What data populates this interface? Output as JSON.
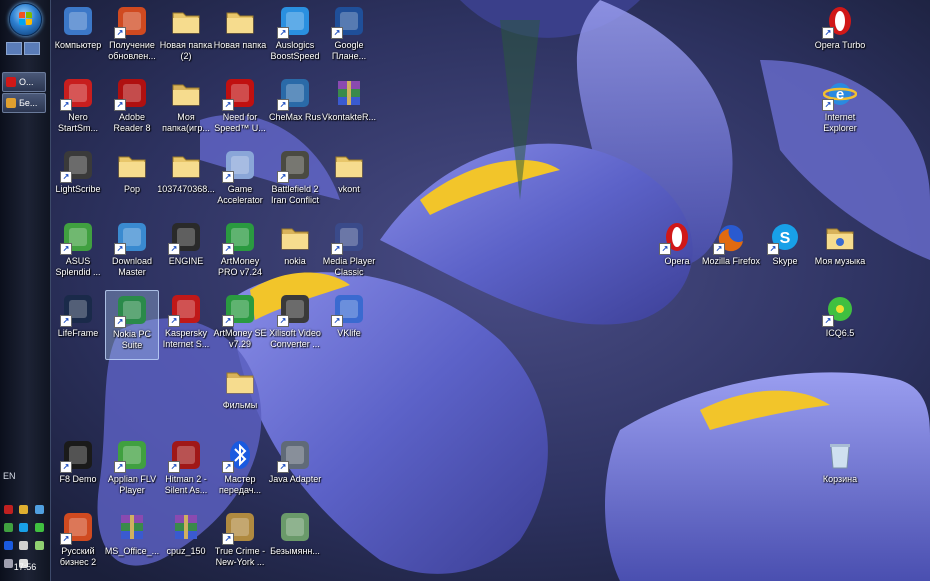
{
  "desktop": {
    "icons": [
      {
        "label": "Компьютер",
        "icon": "computer-icon",
        "color": "#3c78c8"
      },
      {
        "label": "Получение обновлен...",
        "icon": "update-icon",
        "color": "#d04a20"
      },
      {
        "label": "Новая папка (2)",
        "icon": "folder-icon",
        "color": "#e8c66a"
      },
      {
        "label": "Новая папка",
        "icon": "folder-icon",
        "color": "#e8c66a"
      },
      {
        "label": "Auslogics BoostSpeed",
        "icon": "boostspeed-icon",
        "color": "#2a90e0"
      },
      {
        "label": "Google Плане...",
        "icon": "google-earth-icon",
        "color": "#1f4f99"
      },
      {
        "label": "Opera Turbo",
        "icon": "opera-icon",
        "color": "#d01818"
      },
      {
        "label": "Nero StartSm...",
        "icon": "nero-icon",
        "color": "#c81e1e"
      },
      {
        "label": "Adobe Reader 8",
        "icon": "adobe-reader-icon",
        "color": "#b01010"
      },
      {
        "label": "Моя папка(игр...",
        "icon": "folder-icon",
        "color": "#d8b25a"
      },
      {
        "label": "Need for Speed™ U...",
        "icon": "nfs-icon",
        "color": "#c01010"
      },
      {
        "label": "CheMax Rus",
        "icon": "chemax-icon",
        "color": "#2a6aa8"
      },
      {
        "label": "VkontakteR...",
        "icon": "archive-icon",
        "color": "#7a4aa0"
      },
      {
        "label": "Internet Explorer",
        "icon": "internet-explorer-icon",
        "color": "#2a8ae0"
      },
      {
        "label": "LightScribe",
        "icon": "lightscribe-icon",
        "color": "#3a3a3a"
      },
      {
        "label": "Pop",
        "icon": "folder-icon",
        "color": "#e8c66a"
      },
      {
        "label": "1037470368...",
        "icon": "folder-icon",
        "color": "#e8c66a"
      },
      {
        "label": "Game Accelerator",
        "icon": "game-accelerator-icon",
        "color": "#8aa6d8"
      },
      {
        "label": "Battlefield 2 Iran Conflict",
        "icon": "battlefield-icon",
        "color": "#4a4a42"
      },
      {
        "label": "vkont",
        "icon": "folder-icon",
        "color": "#e8c66a"
      },
      {
        "label": "ASUS Splendid ...",
        "icon": "asus-splendid-icon",
        "color": "#40a040"
      },
      {
        "label": "Download Master",
        "icon": "download-master-icon",
        "color": "#3a8ad0"
      },
      {
        "label": "ENGINE",
        "icon": "skull-icon",
        "color": "#2a2a2a"
      },
      {
        "label": "ArtMoney PRO v7.24",
        "icon": "artmoney-icon",
        "color": "#2a9a40"
      },
      {
        "label": "nokia",
        "icon": "folder-icon",
        "color": "#d8b25a"
      },
      {
        "label": "Media Player Classic",
        "icon": "media-player-icon",
        "color": "#3a4a8a"
      },
      {
        "label": "Opera",
        "icon": "opera-icon",
        "color": "#d01818"
      },
      {
        "label": "Mozilla Firefox",
        "icon": "firefox-icon",
        "color": "#e06a10"
      },
      {
        "label": "Skype",
        "icon": "skype-icon",
        "color": "#18a0e8"
      },
      {
        "label": "Моя музыка",
        "icon": "music-folder-icon",
        "color": "#d8b25a"
      },
      {
        "label": "LifeFrame",
        "icon": "lifeframe-icon",
        "color": "#1a2a4a"
      },
      {
        "label": "Nokia PC Suite",
        "icon": "nokia-suite-icon",
        "color": "#2a8a4a"
      },
      {
        "label": "Kaspersky Internet S...",
        "icon": "kaspersky-icon",
        "color": "#c01818"
      },
      {
        "label": "ArtMoney SE v7.29",
        "icon": "artmoney-icon",
        "color": "#2a9a40"
      },
      {
        "label": "Xilisoft Video Converter ...",
        "icon": "film-reel-icon",
        "color": "#3a3a3a"
      },
      {
        "label": "VKlife",
        "icon": "vklife-icon",
        "color": "#3a6ad0"
      },
      {
        "label": "ICQ6.5",
        "icon": "icq-icon",
        "color": "#40c040"
      },
      {
        "label": "Фильмы",
        "icon": "folder-icon",
        "color": "#d8b25a"
      },
      {
        "label": "F8 Demo",
        "icon": "asus-f8-icon",
        "color": "#1a1a1a"
      },
      {
        "label": "Applian FLV Player",
        "icon": "flv-player-icon",
        "color": "#40a040"
      },
      {
        "label": "Hitman 2 - Silent As...",
        "icon": "hitman-icon",
        "color": "#a01818"
      },
      {
        "label": "Мастер передач...",
        "icon": "bluetooth-icon",
        "color": "#1a5ae0"
      },
      {
        "label": "Java Adapter",
        "icon": "gamepad-icon",
        "color": "#606a78"
      },
      {
        "label": "Корзина",
        "icon": "recycle-bin-icon",
        "color": "#9ab0c8"
      },
      {
        "label": "Русский бизнес 2",
        "icon": "rb2-icon",
        "color": "#d04a20"
      },
      {
        "label": "MS_Office_...",
        "icon": "archive-icon",
        "color": "#7a4aa0"
      },
      {
        "label": "cpuz_150",
        "icon": "archive-icon",
        "color": "#7a4aa0"
      },
      {
        "label": "True Crime - New-York ...",
        "icon": "badge-icon",
        "color": "#b08a40"
      },
      {
        "label": "Безымянн...",
        "icon": "image-file-icon",
        "color": "#6a9a6a"
      }
    ]
  },
  "taskbar": {
    "tasks": [
      {
        "label": "O...",
        "icon": "opera-icon",
        "color": "#d01818"
      },
      {
        "label": "Бе...",
        "icon": "paint-icon",
        "color": "#e0a030"
      }
    ],
    "language": "EN",
    "clock": "17:56"
  }
}
